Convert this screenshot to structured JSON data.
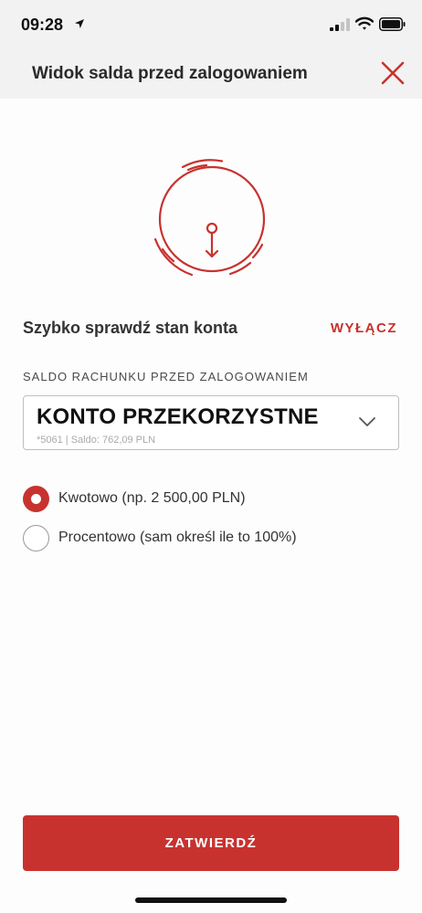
{
  "status_bar": {
    "time": "09:28",
    "icons": [
      "location-arrow-icon",
      "signal-icon",
      "wifi-icon",
      "battery-icon"
    ]
  },
  "header": {
    "title": "Widok salda przed zalogowaniem",
    "close_icon": "close-icon"
  },
  "illustration_icon": "balance-dial-icon",
  "section": {
    "title": "Szybko sprawdź stan konta",
    "disable_label": "WYŁĄCZ"
  },
  "account_field": {
    "label": "SALDO RACHUNKU PRZED ZALOGOWANIEM",
    "value": "KONTO PRZEKORZYSTNE",
    "sub": "*5061 | Saldo: 762,09 PLN"
  },
  "options": [
    {
      "label": "Kwotowo (np. 2 500,00 PLN)",
      "checked": true
    },
    {
      "label": "Procentowo (sam określ ile to 100%)",
      "checked": false
    }
  ],
  "confirm_label": "ZATWIERDŹ",
  "colors": {
    "accent": "#c8322e",
    "header_bg": "#f2f2f2",
    "background": "#fdfdfd"
  }
}
